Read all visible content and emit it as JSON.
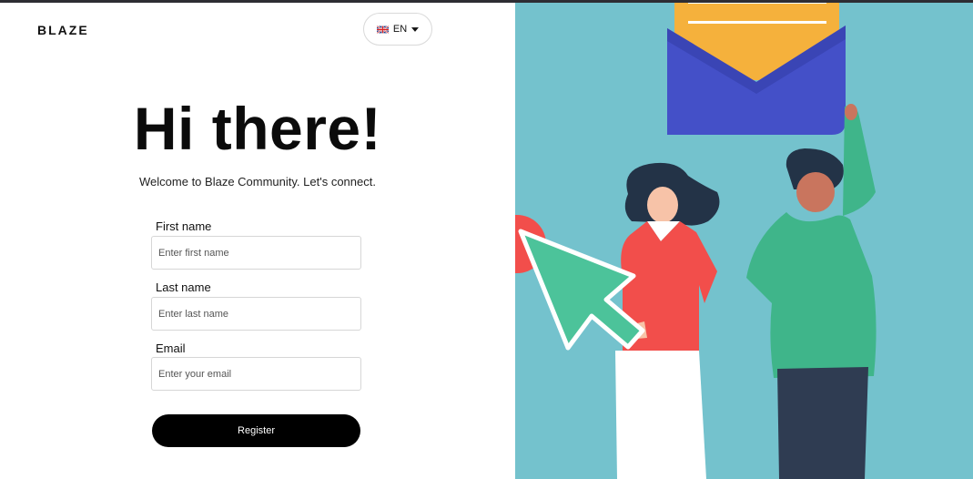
{
  "brand": {
    "logo_text": "BLAZE"
  },
  "language": {
    "code": "EN",
    "flag_icon": "uk-flag-icon",
    "caret_icon": "caret-down-icon"
  },
  "hero": {
    "title": "Hi there!",
    "subtitle": "Welcome to Blaze Community. Let's connect."
  },
  "form": {
    "first_name": {
      "label": "First name",
      "placeholder": "Enter first name",
      "value": ""
    },
    "last_name": {
      "label": "Last name",
      "placeholder": "Enter last name",
      "value": ""
    },
    "email": {
      "label": "Email",
      "placeholder": "Enter your email",
      "value": ""
    },
    "submit_label": "Register"
  },
  "illustration": {
    "description_icons": [
      "envelope-icon",
      "cursor-arrow-icon"
    ],
    "colors": {
      "background": "#74c2cd",
      "envelope": "#4450c8",
      "letter": "#f5b13c",
      "cursor": "#4cc39a",
      "red_shirt": "#f24e4b",
      "green_shirt": "#3fb58a",
      "hair": "#233347",
      "skin_light": "#f7c3a8",
      "skin_dark": "#c9755e",
      "pants_dark": "#2f3c52"
    }
  }
}
